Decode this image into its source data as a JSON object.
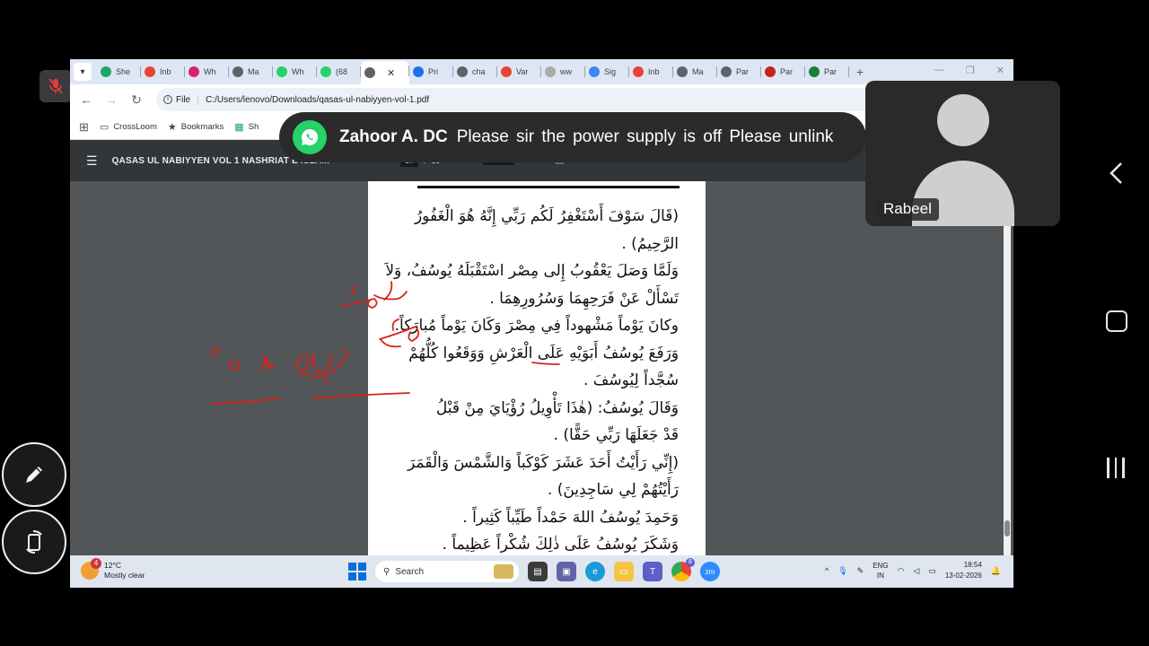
{
  "browser": {
    "tabs": [
      {
        "label": "She",
        "color": "#1fa463"
      },
      {
        "label": "Inb",
        "color": "#ea4335"
      },
      {
        "label": "Wh",
        "color": "#d6246e"
      },
      {
        "label": "Ma",
        "color": "#5f6368"
      },
      {
        "label": "Wh",
        "color": "#25d366"
      },
      {
        "label": "(68",
        "color": "#25d366"
      },
      {
        "label": "",
        "color": "#5f6368",
        "active": true
      },
      {
        "label": "Pri",
        "color": "#1a73e8"
      },
      {
        "label": "cha",
        "color": "#5f6368"
      },
      {
        "label": "Var",
        "color": "#ea4335"
      },
      {
        "label": "ww",
        "color": "#aaaaaa"
      },
      {
        "label": "Sig",
        "color": "#4285f4"
      },
      {
        "label": "Inb",
        "color": "#ea4335"
      },
      {
        "label": "Ma",
        "color": "#5f6368"
      },
      {
        "label": "Par",
        "color": "#5f6368"
      },
      {
        "label": "Par",
        "color": "#c5221f"
      },
      {
        "label": "Par",
        "color": "#188038"
      }
    ],
    "active_tab_close": "✕",
    "new_tab": "+",
    "address": {
      "chip_label": "File",
      "url": "C:/Users/lenovo/Downloads/qasas-ul-nabiyyen-vol-1.pdf"
    },
    "bookmarks": [
      {
        "label": "CrossLoom",
        "icon": "folder-icon"
      },
      {
        "label": "Bookmarks",
        "icon": "star-icon"
      },
      {
        "label": "Sh",
        "icon": "sheets-icon"
      }
    ]
  },
  "pdf": {
    "title": "QASAS UL NABIYYEN VOL 1 NASHRIAT E ISLAM",
    "page_current": "67",
    "page_sep": "/",
    "page_total": "89",
    "zoom": "100%",
    "lines": [
      "(قَالَ سَوْفَ أَسْتَغْفِرُ لَكُم رَبِّي إِنَّهُ هُوَ الْغَفُورُ",
      "الرَّحِيمُ) .",
      "وَلَمَّا وَصَلَ يَعْقُوبُ إِلى مِصْر اسْتَقْبَلَهُ يُوسُفُ، وَلاَ",
      "تَسْأَلْ عَنْ فَرَحِهِمَا وَسُرُورِهِمَا .",
      "وكانَ يَوْماً مَشْهوداً فِي مِصْرَ وَكَانَ يَوْماً مُبارَكاً.",
      "وَرَفَعَ يُوسُفُ أَبَوَيْهِ عَلَى الْعَرْشِ وَوَقَعُوا كُلُّهُمْ",
      "سُجَّداً لِيُوسُفَ .",
      "وَقَالَ يُوسُفُ: (هٰذَا تَأْوِيلُ رُؤْيَايَ مِنْ قَبْلُ",
      "قَدْ جَعَلَهَا رَبِّي حَقًّا) .",
      "(إِنِّي رَأَيْتُ أَحَدَ عَشَرَ كَوْكَباً وَالشَّمْسَ وَالْقَمَرَ",
      "رَأَيْتُهُمْ لِي سَاجِدِينَ) .",
      "وَحَمِدَ يُوسُفُ اللهَ حَمْداً طَيِّباً كَثِيراً .",
      "وَشَكَرَ يُوسُفُ عَلَى ذٰلِكَ شُكْراً عَظِيماً ."
    ]
  },
  "notification": {
    "app_icon": "whatsapp-icon",
    "sender": "Zahoor A. DC",
    "message": "Please  sir the power  supply  is  off Please  unlink"
  },
  "participant": {
    "name": "Rabeel"
  },
  "taskbar": {
    "weather_temp": "12°C",
    "weather_desc": "Mostly clear",
    "weather_badge": "4",
    "search_label": "Search",
    "chrome_badge": "8",
    "zoom_label": "zm",
    "lang_top": "ENG",
    "lang_bottom": "IN",
    "time": "18:54",
    "date": "13-02-2026"
  },
  "colors": {
    "annotation_red": "#d9231e",
    "pdf_bg": "#525659",
    "toolbar_bg": "#323639",
    "whatsapp_green": "#25d366"
  }
}
